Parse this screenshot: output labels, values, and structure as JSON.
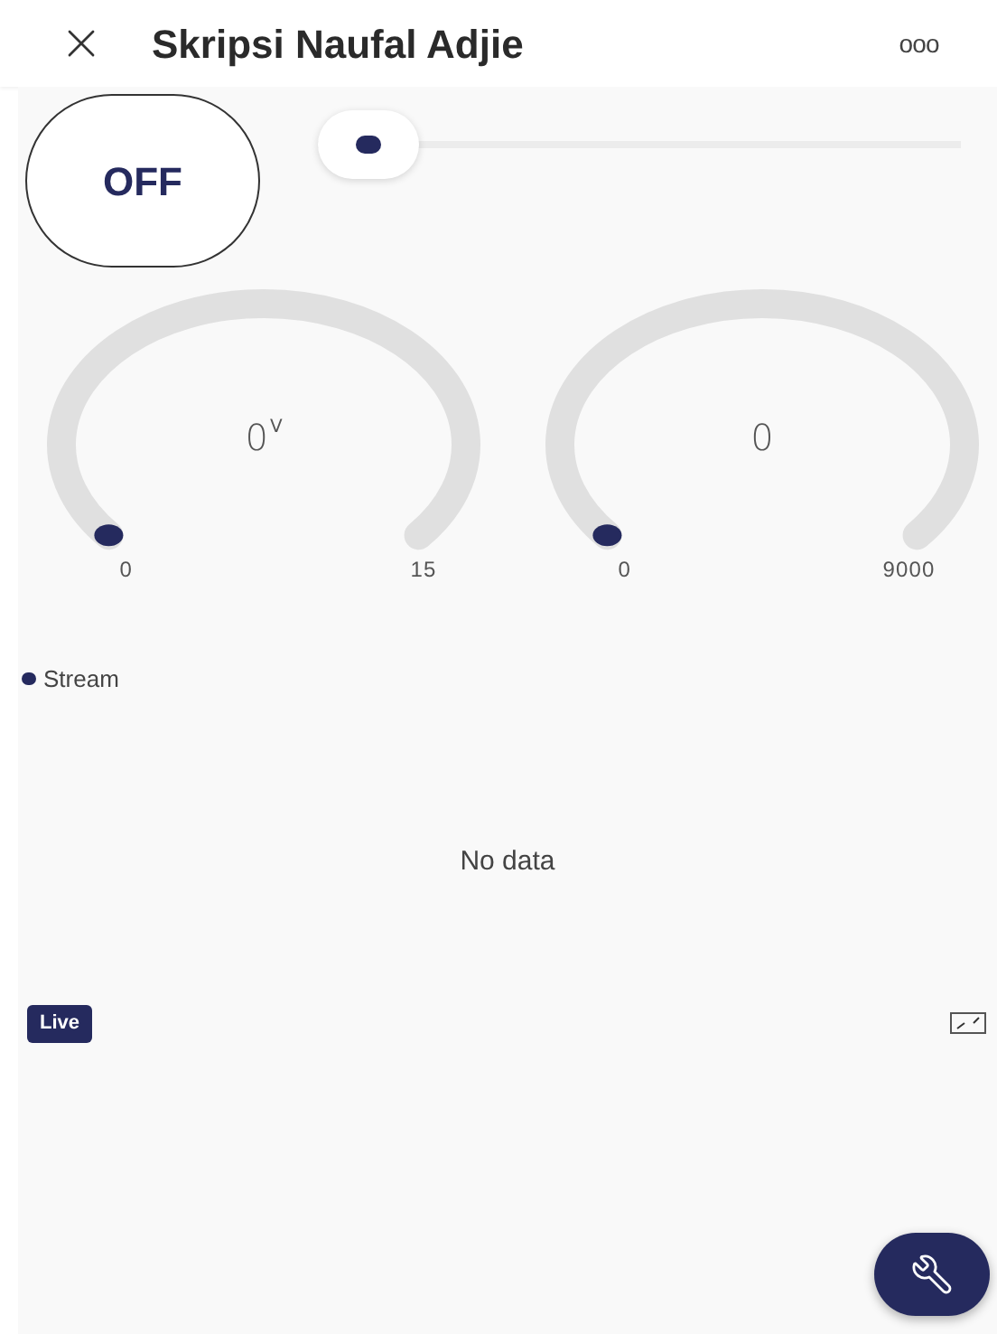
{
  "header": {
    "title": "Skripsi Naufal Adjie",
    "menu": "ooo"
  },
  "switch": {
    "label": "OFF",
    "on": false
  },
  "gauges": [
    {
      "value": "0",
      "unit": "V",
      "min": "0",
      "max": "15"
    },
    {
      "value": "0",
      "min": "0",
      "max": "9000"
    }
  ],
  "chart": {
    "legend": [
      {
        "name": "Stream",
        "color": "#252a5e"
      }
    ],
    "empty_text": "No data",
    "live_badge": "Live"
  }
}
